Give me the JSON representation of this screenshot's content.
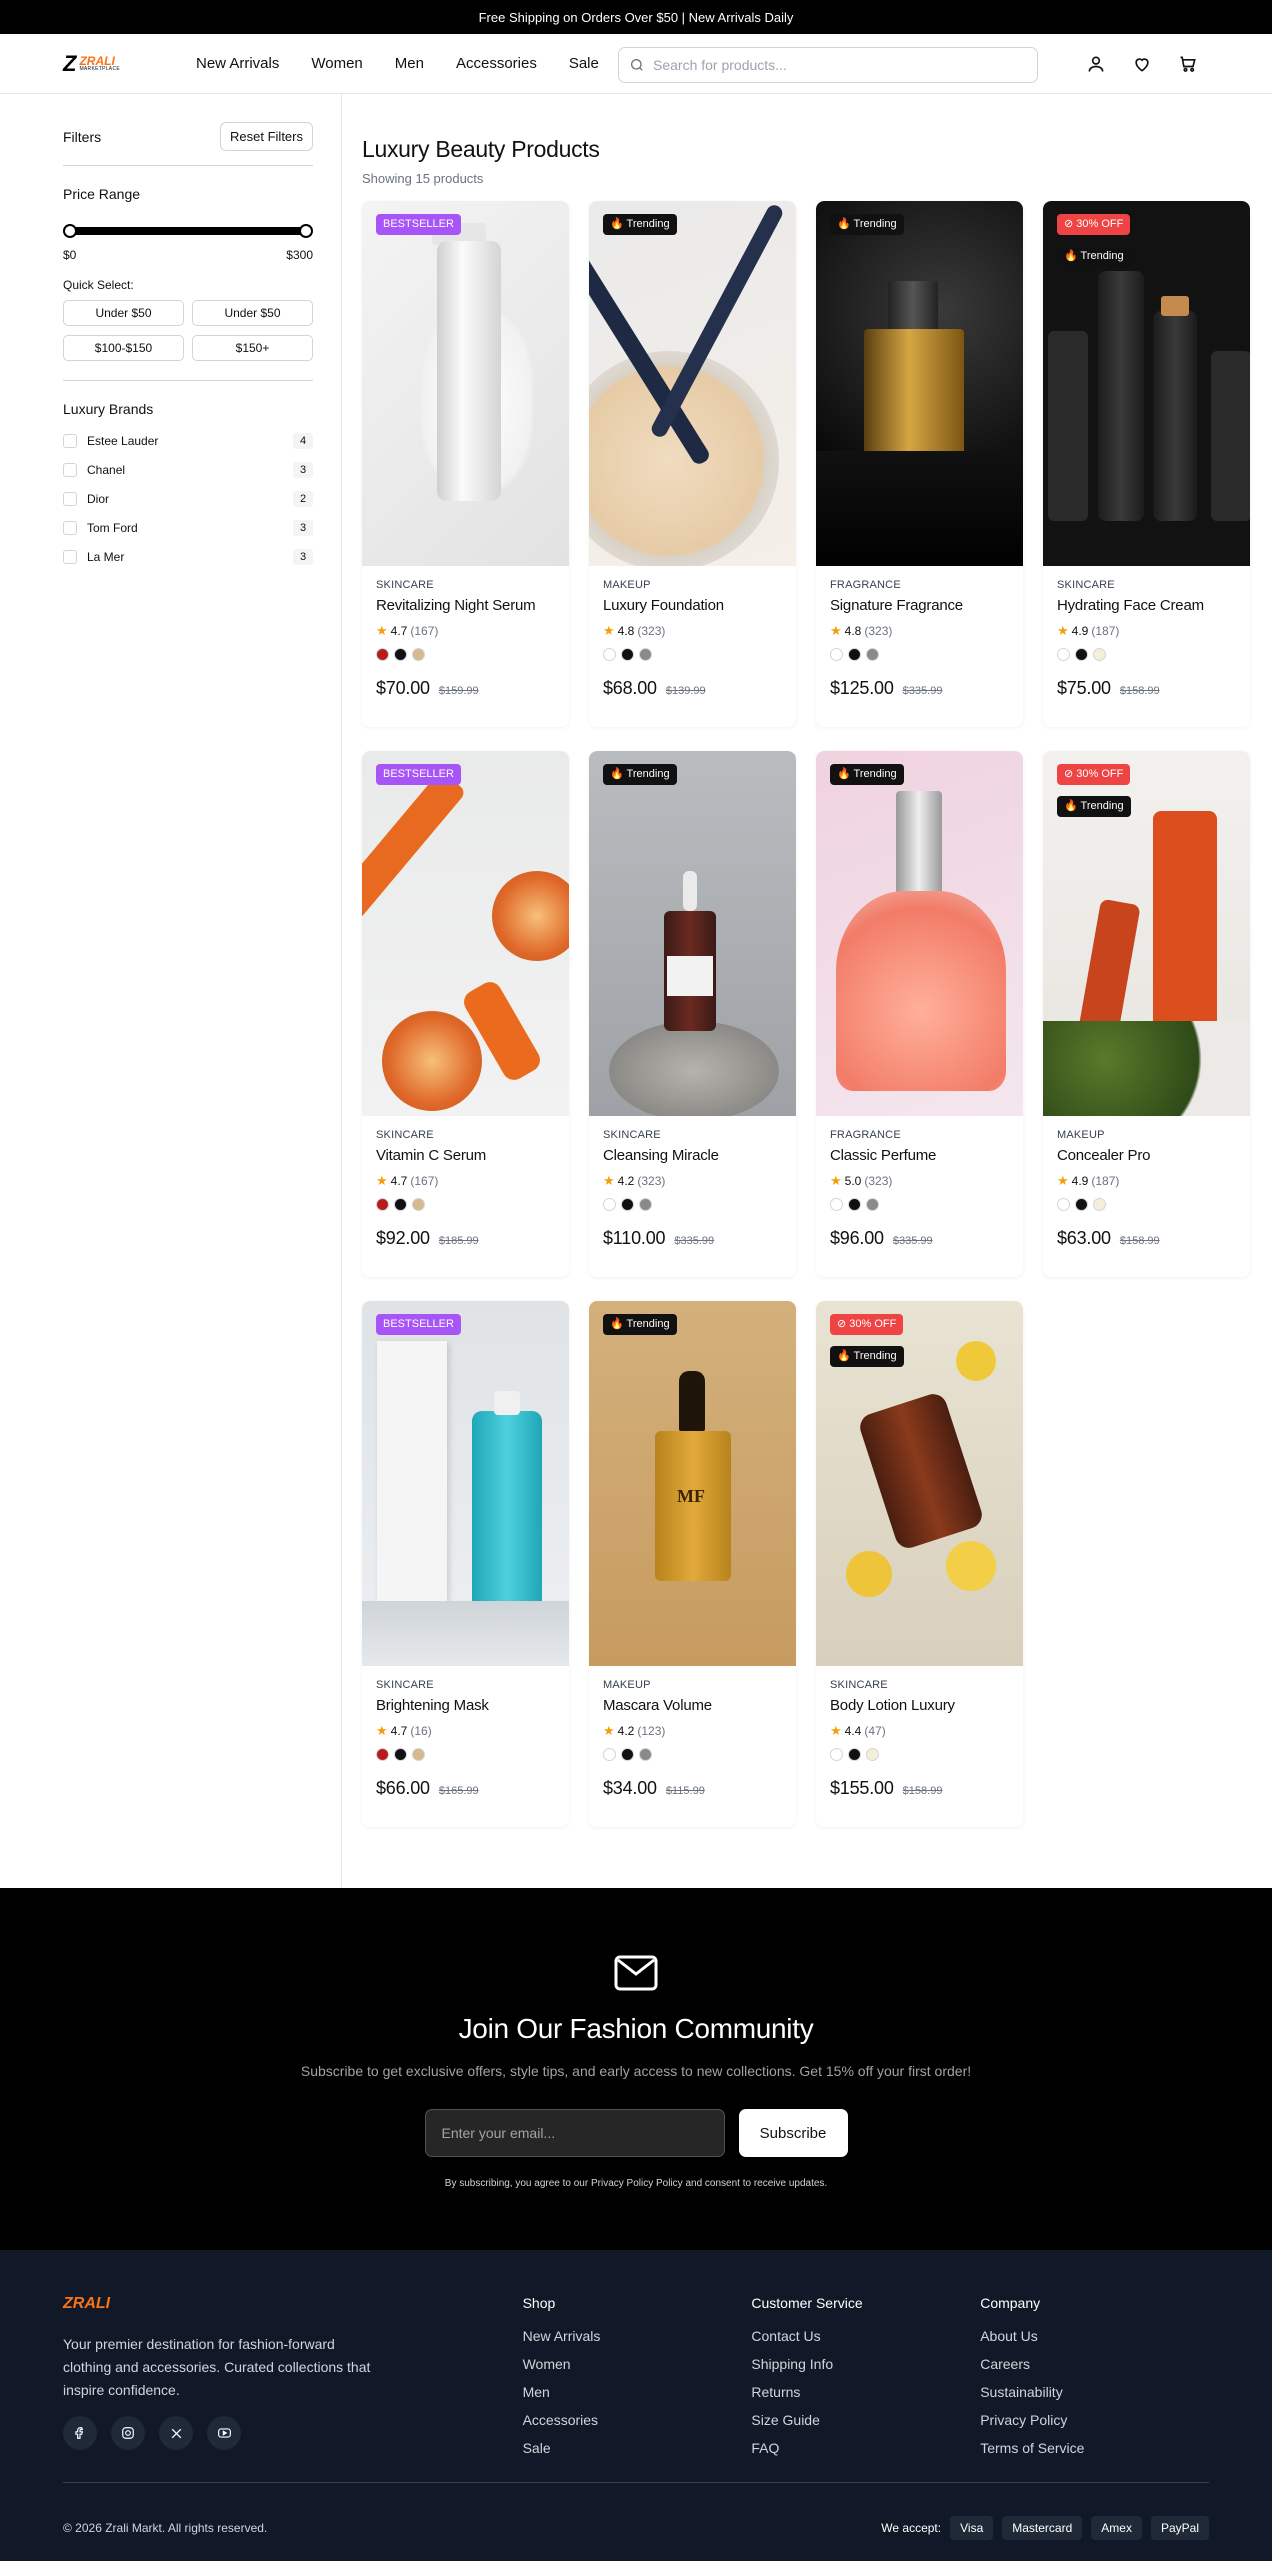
{
  "announcement": "Free Shipping on Orders Over $50 | New Arrivals Daily",
  "brand": {
    "logo_mark": "Z",
    "name": "ZRALI",
    "tagline": "MARKETPLACE"
  },
  "nav": [
    "New Arrivals",
    "Women",
    "Men",
    "Accessories",
    "Sale"
  ],
  "search": {
    "placeholder": "Search for products..."
  },
  "header_icons": [
    "user-icon",
    "heart-icon",
    "cart-icon"
  ],
  "filters": {
    "title": "Filters",
    "reset_label": "Reset Filters",
    "price_range": {
      "title": "Price Range",
      "min_label": "$0",
      "max_label": "$300",
      "min": 0,
      "max": 300
    },
    "quick_select": {
      "title": "Quick Select:",
      "options": [
        "Under $50",
        "Under $50",
        "$100-$150",
        "$150+"
      ]
    },
    "brands": {
      "title": "Luxury Brands",
      "items": [
        {
          "name": "Estee Lauder",
          "count": "4"
        },
        {
          "name": "Chanel",
          "count": "3"
        },
        {
          "name": "Dior",
          "count": "2"
        },
        {
          "name": "Tom Ford",
          "count": "3"
        },
        {
          "name": "La Mer",
          "count": "3"
        }
      ]
    }
  },
  "listing": {
    "title": "Luxury Beauty Products",
    "count_text": "Showing 15 products"
  },
  "products": [
    {
      "category": "SKINCARE",
      "name": "Revitalizing Night Serum",
      "rating": "4.7",
      "reviews": "(167)",
      "price": "$70.00",
      "old_price": "$159.99",
      "badges": [
        {
          "type": "best",
          "label": "BESTSELLER"
        }
      ],
      "swatches": [
        "#b91c1c",
        "#111111",
        "#d6b98c"
      ],
      "image": "bottle-white"
    },
    {
      "category": "MAKEUP",
      "name": "Luxury Foundation",
      "rating": "4.8",
      "reviews": "(323)",
      "price": "$68.00",
      "old_price": "$139.99",
      "badges": [
        {
          "type": "trend",
          "label": "🔥 Trending"
        }
      ],
      "swatches": [
        "#ffffff",
        "#111111",
        "#8a8a8a"
      ],
      "image": "powder"
    },
    {
      "category": "FRAGRANCE",
      "name": "Signature Fragrance",
      "rating": "4.8",
      "reviews": "(323)",
      "price": "$125.00",
      "old_price": "$335.99",
      "badges": [
        {
          "type": "trend",
          "label": "🔥 Trending"
        }
      ],
      "swatches": [
        "#ffffff",
        "#111111",
        "#8a8a8a"
      ],
      "image": "perfume-gold"
    },
    {
      "category": "SKINCARE",
      "name": "Hydrating Face Cream",
      "rating": "4.9",
      "reviews": "(187)",
      "price": "$75.00",
      "old_price": "$158.99",
      "badges": [
        {
          "type": "off",
          "label": "⊘ 30% OFF"
        },
        {
          "type": "trend",
          "label": "🔥 Trending"
        }
      ],
      "swatches": [
        "#ffffff",
        "#111111",
        "#f3efd9"
      ],
      "image": "dark-bottles"
    },
    {
      "category": "SKINCARE",
      "name": "Vitamin C Serum",
      "rating": "4.7",
      "reviews": "(167)",
      "price": "$92.00",
      "old_price": "$185.99",
      "badges": [
        {
          "type": "best",
          "label": "BESTSELLER"
        }
      ],
      "swatches": [
        "#b91c1c",
        "#111111",
        "#d6b98c"
      ],
      "image": "oranges"
    },
    {
      "category": "SKINCARE",
      "name": "Cleansing Miracle",
      "rating": "4.2",
      "reviews": "(323)",
      "price": "$110.00",
      "old_price": "$335.99",
      "badges": [
        {
          "type": "trend",
          "label": "🔥 Trending"
        }
      ],
      "swatches": [
        "#ffffff",
        "#111111",
        "#8a8a8a"
      ],
      "image": "dropper-stone"
    },
    {
      "category": "FRAGRANCE",
      "name": "Classic Perfume",
      "rating": "5.0",
      "reviews": "(323)",
      "price": "$96.00",
      "old_price": "$335.99",
      "badges": [
        {
          "type": "trend",
          "label": "🔥 Trending"
        }
      ],
      "swatches": [
        "#ffffff",
        "#111111",
        "#8a8a8a"
      ],
      "image": "perfume-pink"
    },
    {
      "category": "MAKEUP",
      "name": "Concealer Pro",
      "rating": "4.9",
      "reviews": "(187)",
      "price": "$63.00",
      "old_price": "$158.99",
      "badges": [
        {
          "type": "off",
          "label": "⊘ 30% OFF"
        },
        {
          "type": "trend",
          "label": "🔥 Trending"
        }
      ],
      "swatches": [
        "#ffffff",
        "#111111",
        "#f3efd9"
      ],
      "image": "orange-tubes"
    },
    {
      "category": "SKINCARE",
      "name": "Brightening Mask",
      "rating": "4.7",
      "reviews": "(16)",
      "price": "$66.00",
      "old_price": "$165.99",
      "badges": [
        {
          "type": "best",
          "label": "BESTSELLER"
        }
      ],
      "swatches": [
        "#b91c1c",
        "#111111",
        "#d6b98c"
      ],
      "image": "goodskin"
    },
    {
      "category": "MAKEUP",
      "name": "Mascara Volume",
      "rating": "4.2",
      "reviews": "(123)",
      "price": "$34.00",
      "old_price": "$115.99",
      "badges": [
        {
          "type": "trend",
          "label": "🔥 Trending"
        }
      ],
      "swatches": [
        "#ffffff",
        "#111111",
        "#8a8a8a"
      ],
      "image": "mf-bottle"
    },
    {
      "category": "SKINCARE",
      "name": "Body Lotion Luxury",
      "rating": "4.4",
      "reviews": "(47)",
      "price": "$155.00",
      "old_price": "$158.99",
      "badges": [
        {
          "type": "off",
          "label": "⊘ 30% OFF"
        },
        {
          "type": "trend",
          "label": "🔥 Trending"
        }
      ],
      "swatches": [
        "#ffffff",
        "#111111",
        "#f3efd9"
      ],
      "image": "lemons"
    }
  ],
  "newsletter": {
    "title": "Join Our Fashion Community",
    "subtitle": "Subscribe to get exclusive offers, style tips, and early access to new collections. Get 15% off your first order!",
    "placeholder": "Enter your email...",
    "button": "Subscribe",
    "fine_print": "By subscribing, you agree to our Privacy Policy Policy and consent to receive updates."
  },
  "footer": {
    "logo": "ZRALI",
    "description": "Your premier destination for fashion-forward clothing and accessories. Curated collections that inspire confidence.",
    "social": [
      "facebook-icon",
      "instagram-icon",
      "x-icon",
      "youtube-icon"
    ],
    "columns": [
      {
        "title": "Shop",
        "links": [
          "New Arrivals",
          "Women",
          "Men",
          "Accessories",
          "Sale"
        ]
      },
      {
        "title": "Customer Service",
        "links": [
          "Contact Us",
          "Shipping Info",
          "Returns",
          "Size Guide",
          "FAQ"
        ]
      },
      {
        "title": "Company",
        "links": [
          "About Us",
          "Careers",
          "Sustainability",
          "Privacy Policy",
          "Terms of Service"
        ]
      }
    ],
    "copyright": "© 2026 Zrali Markt. All rights reserved.",
    "payments_label": "We accept:",
    "payments": [
      "Visa",
      "Mastercard",
      "Amex",
      "PayPal"
    ]
  }
}
